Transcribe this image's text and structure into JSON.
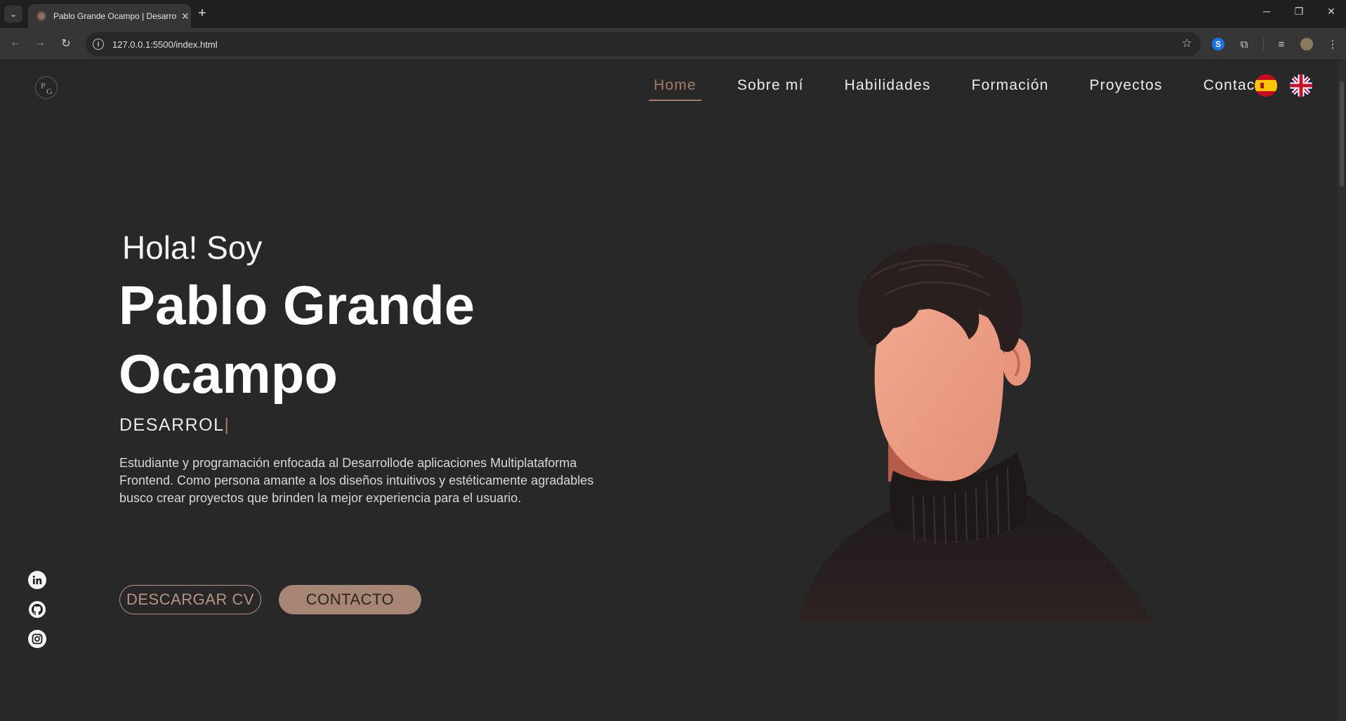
{
  "browser": {
    "tab_title": "Pablo Grande Ocampo | Desarrollador",
    "tab_close": "✕",
    "new_tab": "+",
    "url": "127.0.0.1:5500/index.html",
    "window_controls": {
      "minimize": "─",
      "restore": "❐",
      "close": "✕"
    }
  },
  "logo": {
    "p": "P",
    "g": "G"
  },
  "nav": {
    "items": [
      {
        "label": "Home",
        "active": true
      },
      {
        "label": "Sobre mí",
        "active": false
      },
      {
        "label": "Habilidades",
        "active": false
      },
      {
        "label": "Formación",
        "active": false
      },
      {
        "label": "Proyectos",
        "active": false
      },
      {
        "label": "Contacto",
        "active": false
      }
    ],
    "languages": [
      "spain-flag-icon",
      "uk-flag-icon"
    ]
  },
  "hero": {
    "greeting": "Hola! Soy",
    "name": "Pablo Grande Ocampo",
    "role": "DESARROL",
    "cursor": "|",
    "description": "Estudiante y programación enfocada al Desarrollode aplicaciones Multiplataforma Frontend. Como persona amante a los diseños intuitivos y estéticamente agradables busco crear proyectos que brinden la mejor experiencia para el usuario.",
    "buttons": {
      "download_cv": "DESCARGAR CV",
      "contact": "CONTACTO"
    }
  },
  "social": [
    "linkedin-icon",
    "github-icon",
    "instagram-icon"
  ],
  "colors": {
    "background": "#282828",
    "accent": "#a27c68",
    "button_fill": "#a68574",
    "text": "#ffffff"
  }
}
